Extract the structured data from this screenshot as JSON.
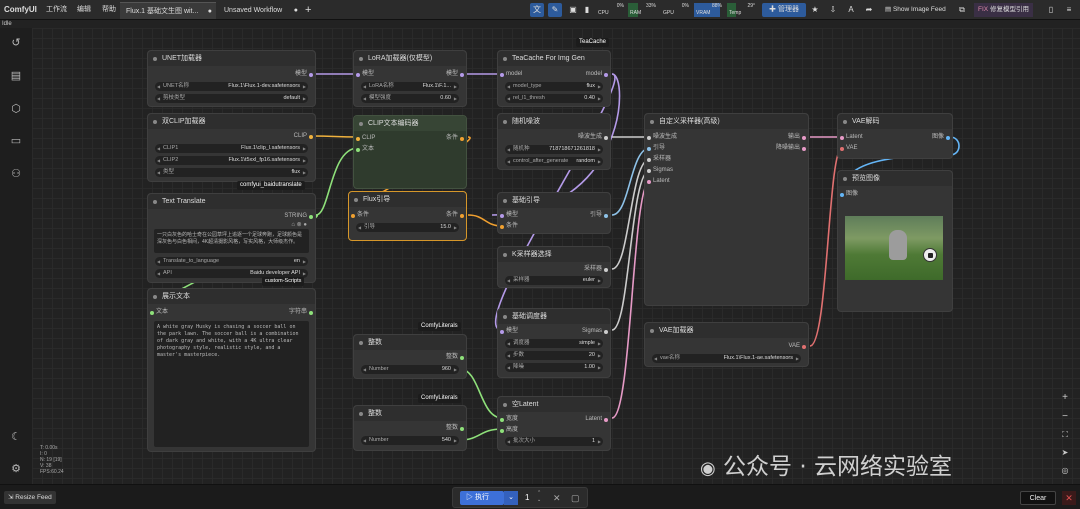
{
  "app": {
    "name": "ComfyUI",
    "status": "Idle"
  },
  "menu": [
    "工作流",
    "编辑",
    "帮助"
  ],
  "tabs": [
    {
      "label": "Flux.1 基础文生图 wit...",
      "dot": "●",
      "active": true
    },
    {
      "label": "Unsaved Workflow",
      "dot": "●",
      "active": false
    }
  ],
  "monitor": {
    "cpu": {
      "label": "CPU",
      "value": "0%"
    },
    "ram": {
      "label": "RAM",
      "value": "33%"
    },
    "gpu": {
      "label": "GPU",
      "value": "0%"
    },
    "vram": {
      "label": "VRAM",
      "value": "88%"
    },
    "temp": {
      "label": "Temp",
      "value": "29°"
    }
  },
  "toolbar": {
    "manager": "管理器",
    "show_image_feed": "Show Image Feed",
    "fix_model": "修复模型引用",
    "fix_prefix": "FIX"
  },
  "nodes": {
    "unet": {
      "title": "UNET加载器",
      "out": "模型",
      "w1_label": "UNET名称",
      "w1_value": "Flux.1\\Flux.1-dev.safetensors",
      "w2_label": "剪枝类型",
      "w2_value": "default"
    },
    "clip": {
      "title": "双CLIP加载器",
      "out": "CLIP",
      "w1_label": "CLIP1",
      "w1_value": "Flux.1\\clip_l.safetensors",
      "w2_label": "CLIP2",
      "w2_value": "Flux.1\\t5xxl_fp16.safetensors",
      "w3_label": "类型",
      "w3_value": "flux"
    },
    "translate": {
      "title": "Text Translate",
      "badge": "comfyui_baidutranslate",
      "out": "STRING",
      "text": "一只白灰色的哈士奇在公园草坪上追逐一个足球奔跑，足球颜色是深灰色与白色相间，4K超清摄影风格，写实风格，大师级杰作。",
      "w1_label": "Translate_to_language",
      "w1_value": "en",
      "w2_label": "API",
      "w2_value": "Baidu developer API",
      "badge2": "custom-Scripts"
    },
    "show": {
      "title": "展示文本",
      "in": "文本",
      "out": "字符串",
      "text": "A white gray Husky is chasing a soccer ball on the park lawn. The soccer ball is a combination of dark gray and white, with a 4K ultra clear photography style, realistic style, and a master's masterpiece."
    },
    "lora": {
      "title": "LoRA加载器(仅模型)",
      "in": "模型",
      "out": "模型",
      "w1_label": "LoRA名称",
      "w1_value": "Flux.1\\F.1...",
      "w2_label": "模型强度",
      "w2_value": "0.60"
    },
    "clipenc": {
      "title": "CLIP文本编码器",
      "in1": "CLIP",
      "in2": "文本",
      "out": "条件"
    },
    "flux": {
      "title": "Flux引导",
      "in": "条件",
      "out": "条件",
      "w1_label": "引导",
      "w1_value": "15.0"
    },
    "int1": {
      "title": "整数",
      "badge": "ComfyLiterals",
      "out": "整数",
      "w1_label": "Number",
      "w1_value": "960"
    },
    "int2": {
      "title": "整数",
      "badge": "ComfyLiterals",
      "out": "整数",
      "w1_label": "Number",
      "w1_value": "540"
    },
    "teacache": {
      "title": "TeaCache For Img Gen",
      "badge": "TeaCache",
      "in": "model",
      "out": "model",
      "w1_label": "model_type",
      "w1_value": "flux",
      "w2_label": "rel_l1_thresh",
      "w2_value": "0.40"
    },
    "noise": {
      "title": "随机噪波",
      "out": "噪波生成",
      "w1_label": "随机种",
      "w1_value": "718718671261818",
      "w2_label": "control_after_generate",
      "w2_value": "random"
    },
    "guider": {
      "title": "基础引导",
      "in1": "模型",
      "in2": "条件",
      "out": "引导"
    },
    "sampler": {
      "title": "K采样器选择",
      "out": "采样器",
      "w1_label": "采样器",
      "w1_value": "euler"
    },
    "sched": {
      "title": "基础调度器",
      "in": "模型",
      "out": "Sigmas",
      "w1_label": "调度器",
      "w1_value": "simple",
      "w2_label": "步数",
      "w2_value": "20",
      "w3_label": "降噪",
      "w3_value": "1.00"
    },
    "latent": {
      "title": "空Latent",
      "in1": "宽度",
      "in2": "高度",
      "out": "Latent",
      "w1_label": "批次大小",
      "w1_value": "1"
    },
    "adv": {
      "title": "自定义采样器(高级)",
      "in1": "噪波生成",
      "in2": "引导",
      "in3": "采样器",
      "in4": "Sigmas",
      "in5": "Latent",
      "out1": "输出",
      "out2": "降噪输出"
    },
    "vaedec": {
      "title": "VAE解码",
      "in1": "Latent",
      "in2": "VAE",
      "out": "图像"
    },
    "preview": {
      "title": "预览图像",
      "in": "图像"
    },
    "vaeload": {
      "title": "VAE加载器",
      "out": "VAE",
      "w1_label": "vae名称",
      "w1_value": "Flux.1\\Flux.1-ae.safetensors"
    }
  },
  "bottom": {
    "resize": "Resize Feed",
    "run": "执行",
    "count": "1",
    "clear": "Clear"
  },
  "stats": [
    "T: 0.00s",
    "I: 0",
    "N: 19 [19]",
    "V: 38",
    "FPS:60.24"
  ],
  "watermark": "公众号 · 云网络实验室"
}
